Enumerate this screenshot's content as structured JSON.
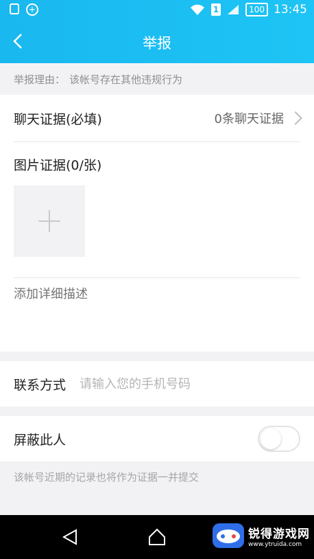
{
  "status_bar": {
    "sim_label": "1",
    "battery": "100",
    "time": "13:45"
  },
  "header": {
    "title": "举报"
  },
  "reason": {
    "label": "举报理由：",
    "value": "该帐号存在其他违规行为"
  },
  "chat_evidence": {
    "label": "聊天证据(必填)",
    "value": "0条聊天证据"
  },
  "image_evidence": {
    "label": "图片证据(0/张)"
  },
  "description": {
    "placeholder": "添加详细描述"
  },
  "contact": {
    "label": "联系方式",
    "placeholder": "请输入您的手机号码"
  },
  "block": {
    "label": "屏蔽此人",
    "enabled": false
  },
  "note": "该帐号近期的记录也将作为证据一并提交",
  "watermark": {
    "name": "锐得游戏网",
    "url": "www.ytruida.com"
  },
  "colors": {
    "header": "#1ec4f5",
    "background": "#f2f2f4"
  }
}
